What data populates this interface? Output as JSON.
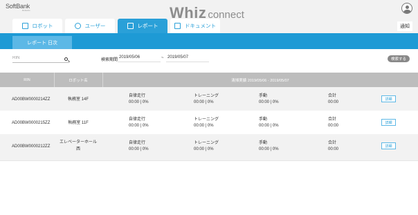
{
  "brand": {
    "name": "SoftBank",
    "sub": "Robotics"
  },
  "logo": {
    "main": "Whiz",
    "suffix": "connect"
  },
  "tabs": [
    {
      "label": "ロボット",
      "icon": "robot-icon"
    },
    {
      "label": "ユーザー",
      "icon": "user-icon"
    },
    {
      "label": "レポート",
      "icon": "report-icon"
    },
    {
      "label": "ドキュメント",
      "icon": "document-icon"
    }
  ],
  "notice_label": "通知",
  "subtab_label": "レポート 日次",
  "search": {
    "rin_placeholder": "RIN",
    "period_label": "検索期間",
    "from_date": "2019/05/06",
    "separator": "~",
    "to_date": "2019/05/07",
    "button_label": "検索する"
  },
  "table": {
    "headers": {
      "rin": "RIN",
      "robot": "ロボット名",
      "results": "清掃実績 2019/05/06 - 2019/05/07"
    },
    "stat_labels": [
      "自律走行",
      "トレーニング",
      "手動",
      "合計"
    ],
    "detail_label": "詳細",
    "rows": [
      {
        "rin": "AD00BW0000214ZZ",
        "robot_lines": [
          "執務室 14F"
        ],
        "stats": [
          "00:00 | 0%",
          "00:00 | 0%",
          "00:00 | 0%",
          "00:00"
        ]
      },
      {
        "rin": "AD00BW0000215ZZ",
        "robot_lines": [
          "執務室 11F"
        ],
        "stats": [
          "00:00 | 0%",
          "00:00 | 0%",
          "00:00 | 0%",
          "00:00"
        ]
      },
      {
        "rin": "AD00BW0000212ZZ",
        "robot_lines": [
          "エレベーターホール",
          "西"
        ],
        "stats": [
          "00:00 | 0%",
          "00:00 | 0%",
          "00:00 | 0%",
          "00:00"
        ]
      }
    ]
  },
  "colors": {
    "accent": "#2aa0d8",
    "band": "#1e9ad5",
    "header_bg": "#f2f2f2",
    "table_header": "#bdbdbd"
  }
}
